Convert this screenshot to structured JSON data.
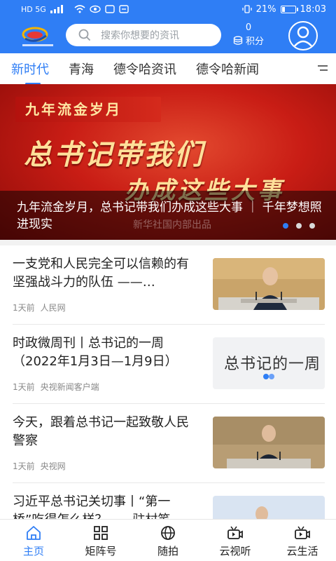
{
  "status_bar": {
    "left": "HD 5G",
    "battery": "21%",
    "time": "18:03"
  },
  "header": {
    "search_placeholder": "搜索你想要的资讯",
    "points_value": "0",
    "points_label": "积分"
  },
  "tabs": [
    {
      "label": "新时代",
      "active": true
    },
    {
      "label": "青海",
      "active": false
    },
    {
      "label": "德令哈资讯",
      "active": false
    },
    {
      "label": "德令哈新闻",
      "active": false
    }
  ],
  "banner": {
    "ribbon": "九年流金岁月",
    "headline_1": "总书记带我们",
    "headline_2": "办成这些大事",
    "caption": "九年流金岁月，总书记带我们办成这些大事 ｜ 千年梦想照进现实",
    "credit": "新华社国内部出品",
    "active_dot": 1
  },
  "news": [
    {
      "title": "一支党和人民完全可以信赖的有坚强战斗力的队伍 ——…",
      "time": "1天前",
      "source": "人民网"
    },
    {
      "title": "时政微周刊丨总书记的一周（2022年1月3日—1月9日）",
      "time": "1天前",
      "source": "央视新闻客户端"
    },
    {
      "title": "今天，跟着总书记一起致敬人民警察",
      "time": "1天前",
      "source": "央视网"
    },
    {
      "title": "习近平总书记关切事丨“第一桥”吃得怎么样？——驻村笔…",
      "time": "",
      "source": ""
    }
  ],
  "thumb2_text": "总书记的一周",
  "bottom_nav": [
    {
      "label": "主页",
      "icon": "home-icon",
      "active": true
    },
    {
      "label": "矩阵号",
      "icon": "grid-icon",
      "active": false
    },
    {
      "label": "随拍",
      "icon": "globe-icon",
      "active": false
    },
    {
      "label": "云视听",
      "icon": "video-icon",
      "active": false
    },
    {
      "label": "云生活",
      "icon": "video-icon",
      "active": false
    }
  ],
  "colors": {
    "primary": "#2f7ef5",
    "banner_red": "#c91d15"
  }
}
